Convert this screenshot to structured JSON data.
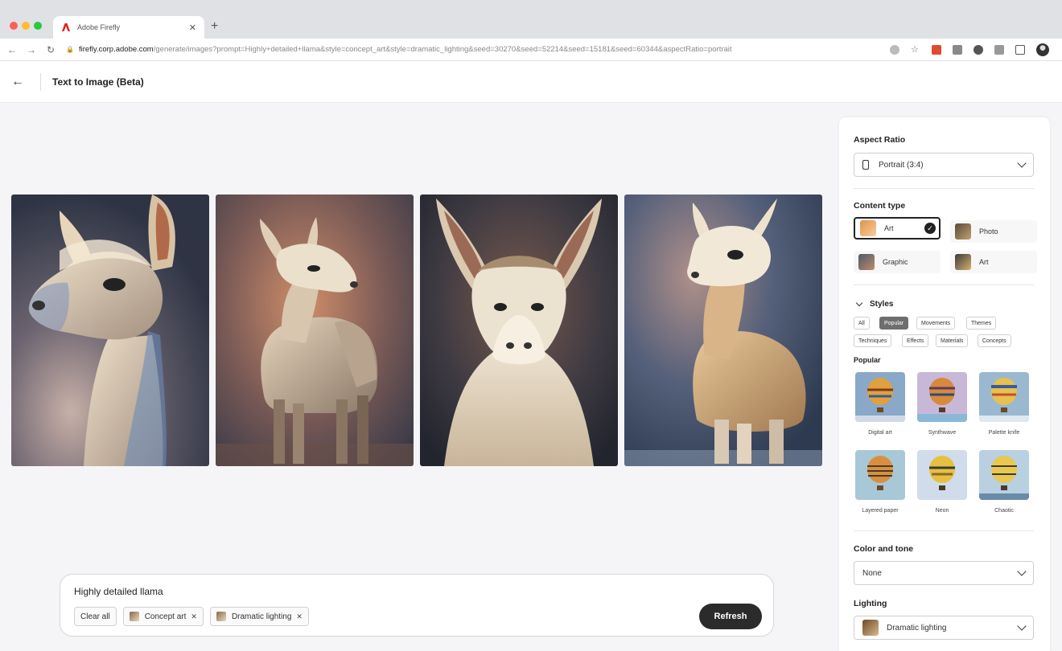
{
  "browser": {
    "tab_title": "Adobe Firefly",
    "url_host": "firefly.corp.adobe.com",
    "url_path": "/generate/images?prompt=Highly+detailed+llama&style=concept_art&style=dramatic_lighting&seed=30270&seed=52214&seed=15181&seed=60344&aspectRatio=portrait",
    "icons": [
      "back-icon",
      "forward-icon",
      "reload-icon",
      "lock-icon",
      "share-icon",
      "star-icon"
    ]
  },
  "header": {
    "title": "Text to Image (Beta)"
  },
  "gallery": {
    "images": [
      {
        "alt": "llama-1",
        "tone": "#5a6070"
      },
      {
        "alt": "llama-2",
        "tone": "#8a6a58"
      },
      {
        "alt": "llama-3",
        "tone": "#3e3c44"
      },
      {
        "alt": "llama-4",
        "tone": "#4a5468"
      }
    ]
  },
  "prompt": {
    "text": "Highly detailed llama",
    "clear_label": "Clear all",
    "chips": [
      {
        "label": "Concept art"
      },
      {
        "label": "Dramatic lighting"
      }
    ],
    "refresh_label": "Refresh"
  },
  "panel": {
    "aspect_ratio": {
      "title": "Aspect Ratio",
      "value": "Portrait (3:4)"
    },
    "content_type": {
      "title": "Content type",
      "options": [
        {
          "label": "Art",
          "selected": true
        },
        {
          "label": "Photo"
        },
        {
          "label": "Graphic"
        },
        {
          "label": "Art"
        }
      ]
    },
    "styles": {
      "title": "Styles",
      "filters": [
        "All",
        "Popular",
        "Movements",
        "Themes",
        "Techniques",
        "Effects",
        "Materials",
        "Concepts"
      ],
      "active_filter": "Popular",
      "section_title": "Popular",
      "tiles": [
        {
          "label": "Digital art"
        },
        {
          "label": "Synthwave"
        },
        {
          "label": "Palette knife"
        },
        {
          "label": "Layered paper"
        },
        {
          "label": "Neon"
        },
        {
          "label": "Chaotic"
        }
      ]
    },
    "color_tone": {
      "title": "Color and tone",
      "value": "None"
    },
    "lighting": {
      "title": "Lighting",
      "value": "Dramatic lighting"
    }
  }
}
